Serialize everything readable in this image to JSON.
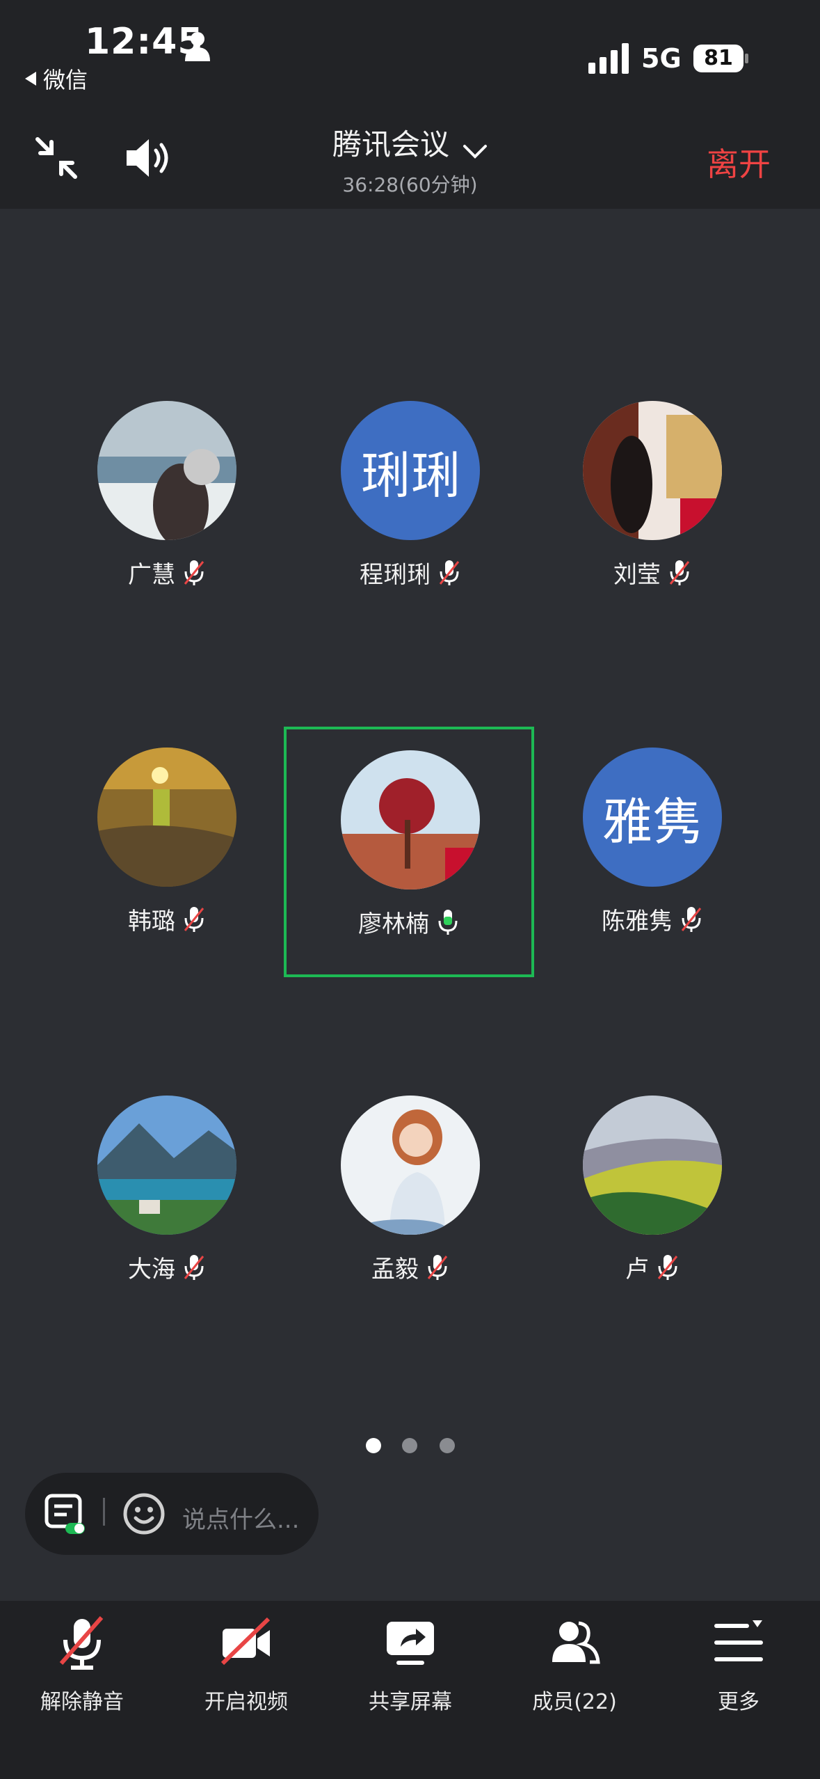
{
  "status_bar": {
    "time": "12:45",
    "back_app": "微信",
    "network": "5G",
    "battery": "81"
  },
  "toolbar": {
    "title": "腾讯会议",
    "timer": "36:28(60分钟)",
    "leave": "离开"
  },
  "participants": [
    {
      "name": "广慧",
      "avatar_type": "photo",
      "muted": true
    },
    {
      "name": "程琍琍",
      "avatar_type": "text",
      "avatar_text": "琍琍",
      "muted": true
    },
    {
      "name": "刘莹",
      "avatar_type": "photo",
      "muted": true
    },
    {
      "name": "韩璐",
      "avatar_type": "photo",
      "muted": true
    },
    {
      "name": "廖林楠",
      "avatar_type": "photo",
      "muted": false,
      "speaking": true
    },
    {
      "name": "陈雅隽",
      "avatar_type": "text",
      "avatar_text": "雅隽",
      "muted": true
    },
    {
      "name": "大海",
      "avatar_type": "photo",
      "muted": true
    },
    {
      "name": "孟毅",
      "avatar_type": "photo",
      "muted": true
    },
    {
      "name": "卢",
      "avatar_type": "photo",
      "muted": true
    }
  ],
  "pagination": {
    "current": 1,
    "total": 3
  },
  "chat": {
    "placeholder": "说点什么..."
  },
  "bottom_bar": {
    "unmute": "解除静音",
    "video": "开启视频",
    "share": "共享屏幕",
    "members": "成员(22)",
    "more": "更多"
  },
  "colors": {
    "active_border": "#1db954",
    "leave": "#ef4343",
    "text_avatar_bg": "#3e6ec2"
  }
}
